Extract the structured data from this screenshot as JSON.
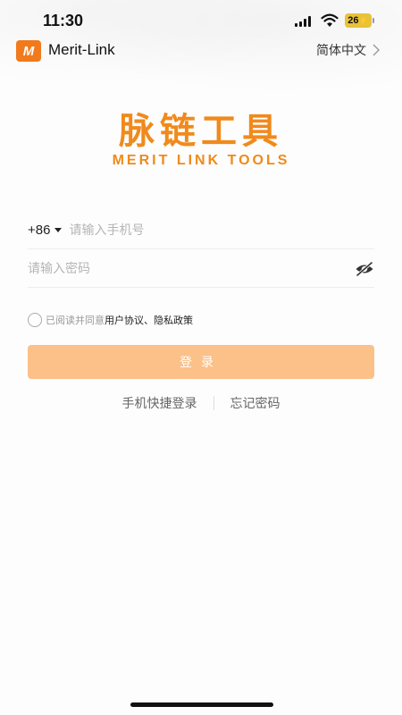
{
  "status_bar": {
    "time": "11:30",
    "battery": "26"
  },
  "header": {
    "app_logo": "M",
    "app_name": "Merit-Link",
    "language": "简体中文"
  },
  "brand": {
    "name_cn": "脉链工具",
    "name_en": "MERIT LINK TOOLS"
  },
  "form": {
    "country_code": "+86",
    "phone_placeholder": "请输入手机号",
    "phone_value": "",
    "password_placeholder": "请输入密码",
    "password_value": ""
  },
  "agreement": {
    "prefix": "已阅读并同意",
    "user_agreement": "用户协议",
    "separator": "、",
    "privacy_policy": "隐私政策",
    "checked": false
  },
  "actions": {
    "login_label": "登录",
    "quick_login": "手机快捷登录",
    "forgot_password": "忘记密码"
  },
  "colors": {
    "brand": "#f08a1c",
    "login_button": "#fcc089"
  },
  "icons": [
    "signal-icon",
    "wifi-icon",
    "battery-icon",
    "chevron-right-icon",
    "caret-down-icon",
    "eye-off-icon"
  ]
}
